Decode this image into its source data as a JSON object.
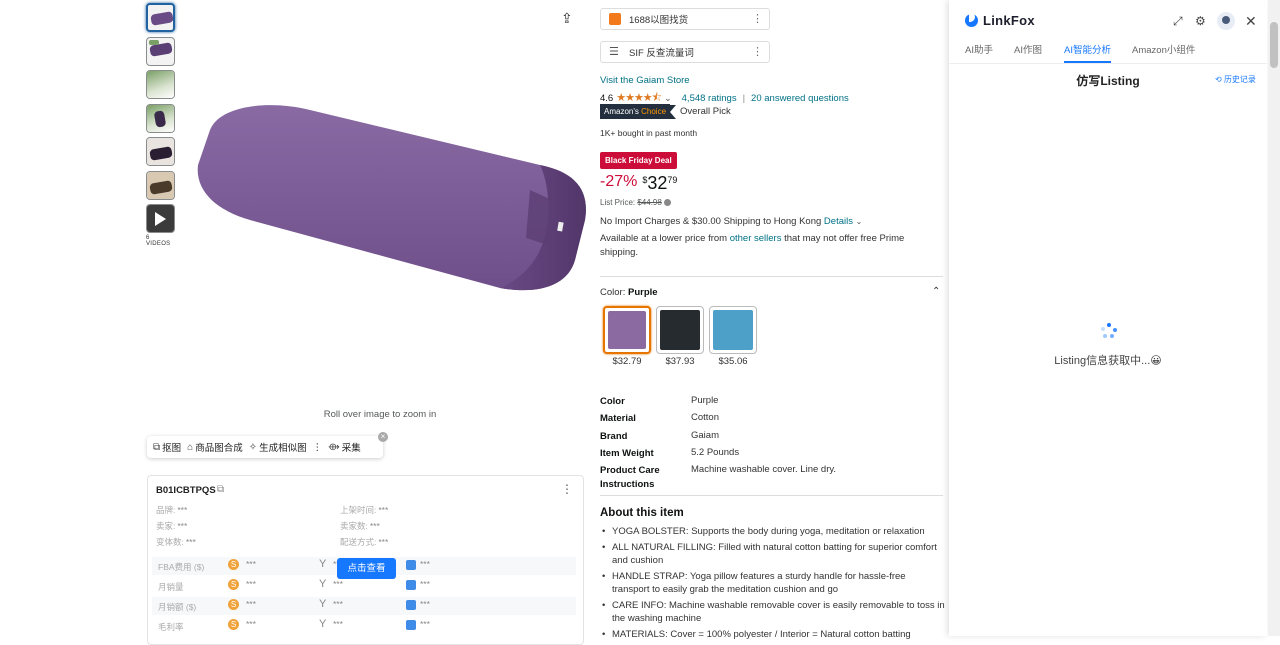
{
  "gallery": {
    "videos_label": "6 VIDEOS",
    "zoom_hint": "Roll over image to zoom in"
  },
  "toolbar": {
    "items": [
      "抠图",
      "商品图合成",
      "生成相似图",
      "采集"
    ],
    "sep": "⋮"
  },
  "product_card": {
    "asin": "B01ICBTPQS",
    "fields": [
      {
        "label": "品牌:",
        "value": "***"
      },
      {
        "label": "上架时间:",
        "value": "***"
      },
      {
        "label": "卖家:",
        "value": "***"
      },
      {
        "label": "卖家数:",
        "value": "***"
      },
      {
        "label": "变体数:",
        "value": "***"
      },
      {
        "label": "配送方式:",
        "value": "***"
      }
    ],
    "metrics": [
      {
        "label": "FBA费用 ($)",
        "v1": "***",
        "v2": "***",
        "v3": "***"
      },
      {
        "label": "月销量",
        "v1": "***",
        "v2": "***",
        "v3": "***"
      },
      {
        "label": "月销额 ($)",
        "v1": "***",
        "v2": "***",
        "v3": "***"
      },
      {
        "label": "毛利率",
        "v1": "***",
        "v2": "***",
        "v3": "***"
      }
    ],
    "view_button": "点击查看",
    "y_glyph": "Y",
    "s_glyph": "S"
  },
  "tools": {
    "pill1": "1688以图找货",
    "pill2": "SIF 反查流量词"
  },
  "buybox": {
    "store_link": "Visit the Gaiam Store",
    "rating_value": "4.6",
    "stars": "★★★★⯪",
    "rating_caret": "⌄",
    "ratings_count": "4,548 ratings",
    "separator": "|",
    "questions": "20 answered questions",
    "choice_prefix": "Amazon's",
    "choice_word": "Choice",
    "overall_pick": "Overall Pick",
    "bought": "1K+ bought in past month",
    "deal_badge": "Black Friday Deal",
    "discount": "-27%",
    "currency": "$",
    "price_whole": "32",
    "price_cents": "79",
    "list_price_label": "List Price:",
    "list_price": "$44.98",
    "shipping": "No Import Charges & $30.00 Shipping to Hong Kong",
    "details_link": "Details",
    "avail_pre": "Available at a lower price from",
    "other_sellers": "other sellers",
    "avail_post": "that may not offer free Prime shipping.",
    "color_label": "Color:",
    "color_value": "Purple",
    "swatches": [
      {
        "price": "$32.79",
        "color": "#8a6aa1"
      },
      {
        "price": "$37.93",
        "color": "#262b30"
      },
      {
        "price": "$35.06",
        "color": "#4da1c9"
      }
    ],
    "specs": [
      {
        "key": "Color",
        "value": "Purple"
      },
      {
        "key": "Material",
        "value": "Cotton"
      },
      {
        "key": "Brand",
        "value": "Gaiam"
      },
      {
        "key": "Item Weight",
        "value": "5.2 Pounds"
      },
      {
        "key": "Product Care Instructions",
        "value": "Machine washable cover. Line dry."
      }
    ],
    "about_title": "About this item",
    "bullets": [
      "YOGA BOLSTER: Supports the body during yoga, meditation or relaxation",
      "ALL NATURAL FILLING: Filled with natural cotton batting for superior comfort and cushion",
      "HANDLE STRAP: Yoga pillow features a sturdy handle for hassle-free transport to easily grab the meditation cushion and go",
      "CARE INFO: Machine washable removable cover is easily removable to toss in the washing machine",
      "MATERIALS: Cover = 100% polyester / Interior = Natural cotton batting"
    ]
  },
  "panel": {
    "brand": "LinkFox",
    "tabs": [
      "AI助手",
      "AI作图",
      "AI智能分析",
      "Amazon小组件"
    ],
    "active_tab_index": 2,
    "title": "仿写Listing",
    "history": "历史记录",
    "loading": "Listing信息获取中...😀",
    "accent": "#1677ff"
  }
}
